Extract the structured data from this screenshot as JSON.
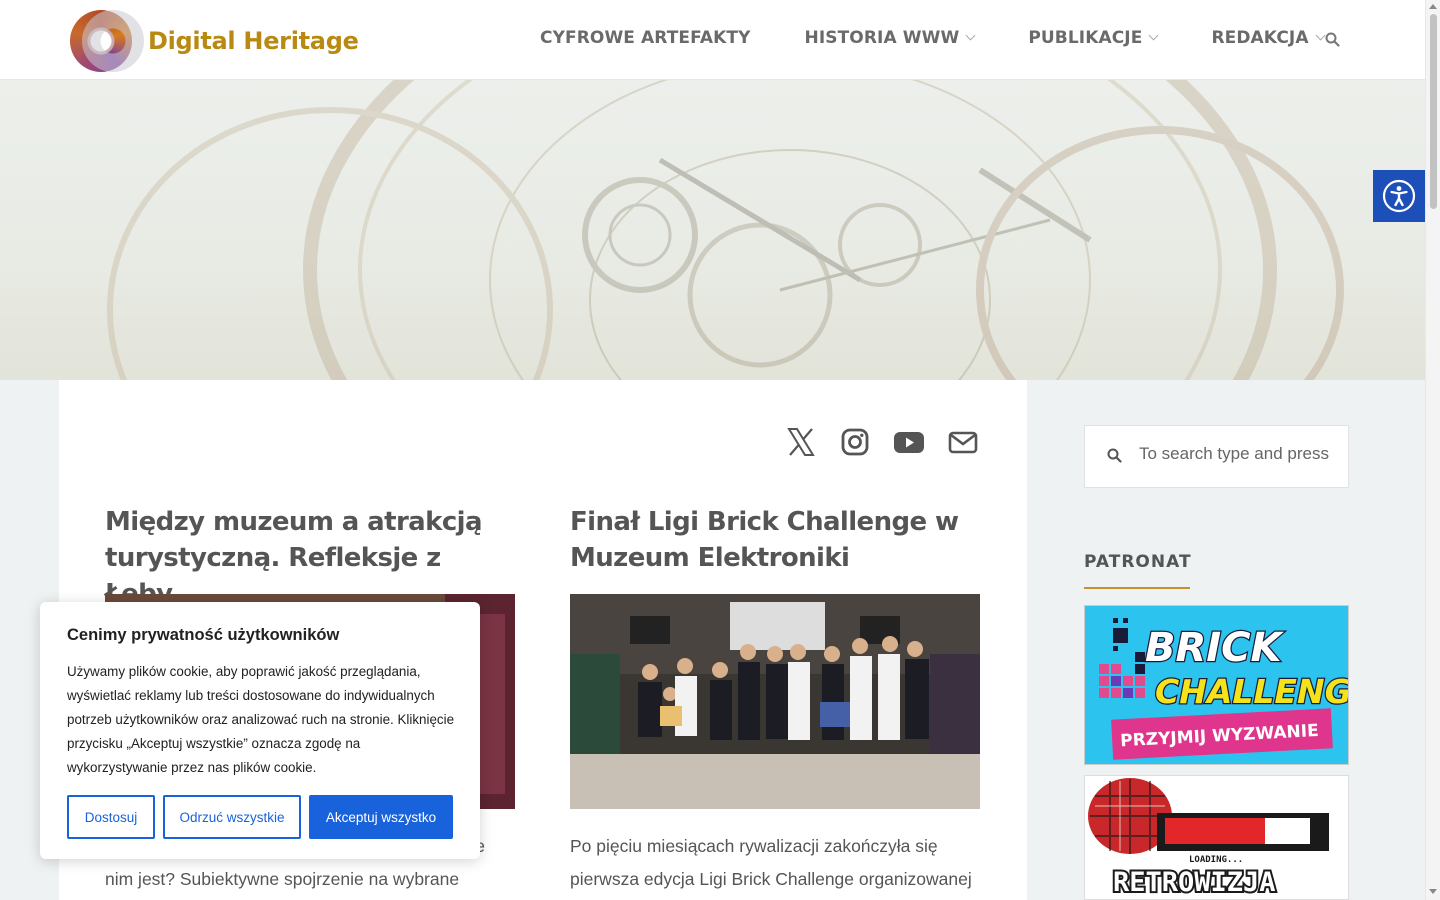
{
  "site": {
    "name": "Digital Heritage",
    "brand_color": "#b98a12"
  },
  "nav": {
    "items": [
      {
        "label": "CYFROWE ARTEFAKTY",
        "has_dropdown": false
      },
      {
        "label": "HISTORIA WWW",
        "has_dropdown": true
      },
      {
        "label": "PUBLIKACJE",
        "has_dropdown": true
      },
      {
        "label": "REDAKCJA",
        "has_dropdown": true
      }
    ],
    "search_icon": "search-icon"
  },
  "social": [
    "x-icon",
    "instagram-icon",
    "youtube-icon",
    "mail-icon"
  ],
  "posts": [
    {
      "title": "Między muzeum a atrakcją turystyczną. Refleksje z Łeby",
      "excerpt_visible": "e\nnim jest? Subiektywne spojrzenie na wybrane atrakcje"
    },
    {
      "title": "Finał Ligi Brick Challenge w Muzeum Elektroniki",
      "excerpt": "Po pięciu miesiącach rywalizacji zakończyła się pierwsza edycja Ligi Brick Challenge organizowanej"
    }
  ],
  "sidebar": {
    "search_placeholder": "To search type and press",
    "widget_title": "PATRONAT",
    "banners": [
      {
        "lines": [
          "BRICK",
          "CHALLENGE"
        ],
        "cta": "PRZYJMIJ WYZWANIE"
      },
      {
        "loading": "LOADING...",
        "name": "RETROWIZJA"
      }
    ]
  },
  "cookie": {
    "title": "Cenimy prywatność użytkowników",
    "text": "Używamy plików cookie, aby poprawić jakość przeglądania, wyświetlać reklamy lub treści dostosowane do indywidualnych potrzeb użytkowników oraz analizować ruch na stronie. Kliknięcie przycisku „Akceptuj wszystkie” oznacza zgodę na wykorzystywanie przez nas plików cookie.",
    "buttons": {
      "customize": "Dostosuj",
      "reject": "Odrzuć wszystkie",
      "accept": "Akceptuj wszystko"
    },
    "accent": "#1863dc"
  },
  "accessibility": {
    "icon": "accessibility-icon",
    "color": "#1d4fb8"
  }
}
